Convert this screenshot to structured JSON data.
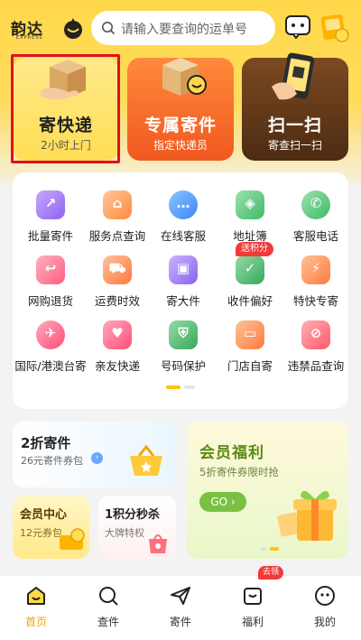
{
  "app": {
    "logo_text": "韵达",
    "logo_sub": "EXPRESS"
  },
  "search": {
    "placeholder": "请输入要查询的运单号"
  },
  "hero": [
    {
      "title": "寄快递",
      "subtitle": "2小时上门"
    },
    {
      "title": "专属寄件",
      "subtitle": "指定快递员"
    },
    {
      "title": "扫一扫",
      "subtitle": "寄查扫一扫"
    }
  ],
  "services": [
    {
      "label": "批量寄件",
      "icon": "batch-send-icon",
      "color": "#a57cf7",
      "glyph": "↗"
    },
    {
      "label": "服务点查询",
      "icon": "service-point-icon",
      "color": "#ff9f5a",
      "glyph": "⌂"
    },
    {
      "label": "在线客服",
      "icon": "online-service-icon",
      "color": "#4c9cff",
      "glyph": "…"
    },
    {
      "label": "地址簿",
      "icon": "address-book-icon",
      "color": "#52c27a",
      "glyph": "◈"
    },
    {
      "label": "客服电话",
      "icon": "phone-icon",
      "color": "#52c27a",
      "glyph": "✆"
    },
    {
      "label": "网购退货",
      "icon": "return-goods-icon",
      "color": "#ff6f8a",
      "glyph": "↩"
    },
    {
      "label": "运费时效",
      "icon": "freight-time-icon",
      "color": "#ff8a4d",
      "glyph": "⛟"
    },
    {
      "label": "寄大件",
      "icon": "large-item-icon",
      "color": "#9a7cf2",
      "glyph": "▣"
    },
    {
      "label": "收件偏好",
      "icon": "receive-pref-icon",
      "color": "#45b764",
      "glyph": "✓"
    },
    {
      "label": "特快专寄",
      "icon": "express-icon",
      "color": "#ff8d4a",
      "glyph": "⚡"
    },
    {
      "label": "国际/港澳台寄",
      "icon": "international-icon",
      "color": "#ff5f86",
      "glyph": "✈"
    },
    {
      "label": "亲友快递",
      "icon": "friends-icon",
      "color": "#ff5f86",
      "glyph": "♥"
    },
    {
      "label": "号码保护",
      "icon": "number-protect-icon",
      "color": "#45b764",
      "glyph": "⛨"
    },
    {
      "label": "门店自寄",
      "icon": "store-icon",
      "color": "#ff8a4d",
      "glyph": "▭"
    },
    {
      "label": "违禁品查询",
      "icon": "prohibited-icon",
      "color": "#ff5f70",
      "glyph": "⊘"
    }
  ],
  "points_badge": "送积分",
  "promos": {
    "coupon": {
      "title": "2折寄件",
      "subtitle": "26元寄件券包",
      "arrow": "›"
    },
    "member": {
      "title": "会员中心",
      "subtitle": "12元券包"
    },
    "points": {
      "title": "1积分秒杀",
      "subtitle": "大牌特权"
    },
    "benefit": {
      "title": "会员福利",
      "subtitle": "5折寄件券限时抢",
      "button": "GO ›"
    }
  },
  "tabs": [
    {
      "label": "首页",
      "icon": "home-icon"
    },
    {
      "label": "查件",
      "icon": "track-icon"
    },
    {
      "label": "寄件",
      "icon": "send-icon"
    },
    {
      "label": "福利",
      "icon": "welfare-icon"
    },
    {
      "label": "我的",
      "icon": "profile-icon"
    }
  ],
  "tab_badge": "去领",
  "colors": {
    "brand_yellow": "#ffd84a",
    "accent_orange": "#f0581f",
    "frame_red": "#e0101e",
    "active_tab": "#f0a800"
  }
}
